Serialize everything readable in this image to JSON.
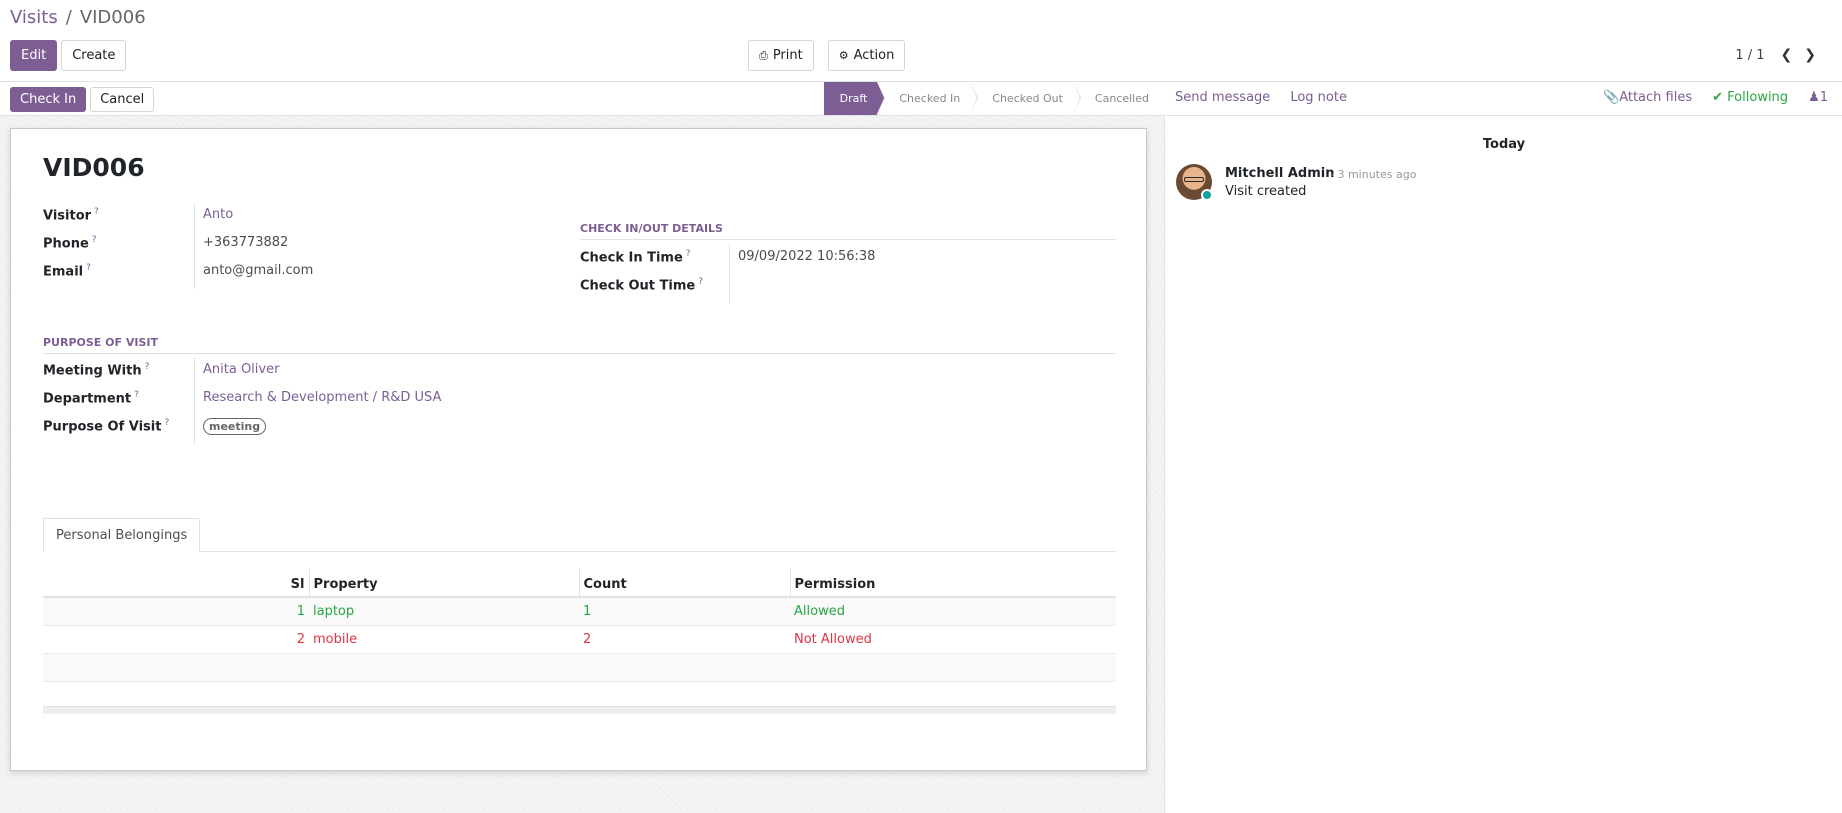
{
  "breadcrumb": {
    "parent": "Visits",
    "separator": "/",
    "current": "VID006"
  },
  "toolbar": {
    "edit": "Edit",
    "create": "Create",
    "print": "Print",
    "action": "Action"
  },
  "pager": {
    "value": "1 / 1"
  },
  "statusbar": {
    "check_in": "Check In",
    "cancel": "Cancel",
    "stages": [
      "Draft",
      "Checked In",
      "Checked Out",
      "Cancelled"
    ],
    "active_stage": "Draft"
  },
  "record": {
    "title": "VID006",
    "visitor_label": "Visitor",
    "visitor": "Anto",
    "phone_label": "Phone",
    "phone": "+363773882",
    "email_label": "Email",
    "email": "anto@gmail.com",
    "checkinout_section": "CHECK IN/OUT DETAILS",
    "check_in_label": "Check In Time",
    "check_in_time": "09/09/2022 10:56:38",
    "check_out_label": "Check Out Time",
    "check_out_time": "",
    "purpose_section": "PURPOSE OF VISIT",
    "meeting_with_label": "Meeting With",
    "meeting_with": "Anita Oliver",
    "department_label": "Department",
    "department": "Research & Development / R&D USA",
    "purpose_label": "Purpose Of Visit",
    "purpose_tag": "meeting",
    "help_mark": "?"
  },
  "tabs": {
    "personal_belongings": "Personal Belongings"
  },
  "belongings": {
    "columns": [
      "Sl",
      "Property",
      "Count",
      "Permission"
    ],
    "rows": [
      {
        "sl": "1",
        "property": "laptop",
        "count": "1",
        "permission": "Allowed"
      },
      {
        "sl": "2",
        "property": "mobile",
        "count": "2",
        "permission": "Not Allowed"
      }
    ]
  },
  "chatter": {
    "send_message": "Send message",
    "log_note": "Log note",
    "attach_files": "Attach files",
    "following": "Following",
    "followers_count": "1",
    "day_separator": "Today",
    "messages": [
      {
        "author": "Mitchell Admin",
        "date": "- 3 minutes ago",
        "body": "Visit created"
      }
    ]
  },
  "colors": {
    "brand": "#7c5e94",
    "success": "#28a745",
    "danger": "#dc3545"
  }
}
